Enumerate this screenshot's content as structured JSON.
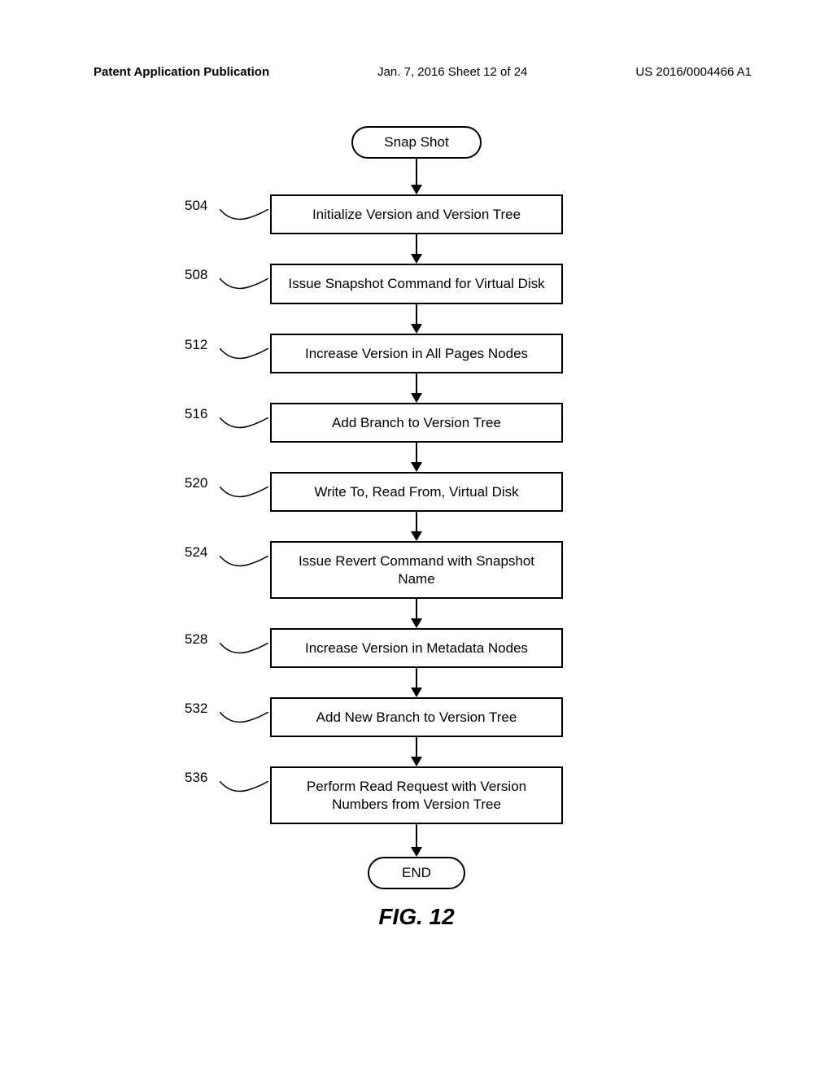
{
  "header": {
    "left": "Patent Application Publication",
    "center": "Jan. 7, 2016   Sheet 12 of 24",
    "right": "US 2016/0004466 A1"
  },
  "flow": {
    "start": "Snap Shot",
    "end": "END",
    "steps": [
      {
        "num": "504",
        "text": "Initialize Version and Version Tree",
        "lines": 1
      },
      {
        "num": "508",
        "text": "Issue Snapshot Command for Virtual Disk",
        "lines": 1
      },
      {
        "num": "512",
        "text": "Increase Version in All Pages Nodes",
        "lines": 1
      },
      {
        "num": "516",
        "text": "Add Branch to Version Tree",
        "lines": 1
      },
      {
        "num": "520",
        "text": "Write To, Read From, Virtual Disk",
        "lines": 1
      },
      {
        "num": "524",
        "text": "Issue Revert Command with Snapshot Name",
        "lines": 2
      },
      {
        "num": "528",
        "text": "Increase Version in Metadata Nodes",
        "lines": 1
      },
      {
        "num": "532",
        "text": "Add New Branch to Version Tree",
        "lines": 1
      },
      {
        "num": "536",
        "text": "Perform Read Request with Version Numbers from Version Tree",
        "lines": 2
      }
    ]
  },
  "caption": "FIG. 12"
}
